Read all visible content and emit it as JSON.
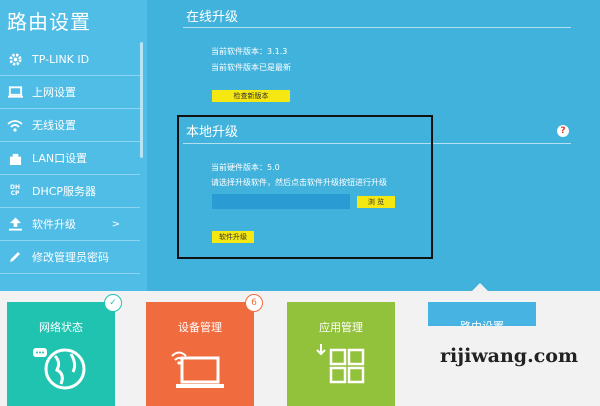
{
  "app": {
    "title": "路由设置"
  },
  "sidebar": {
    "items": [
      {
        "label": "TP-LINK ID",
        "icon": "gear-icon"
      },
      {
        "label": "上网设置",
        "icon": "laptop-icon"
      },
      {
        "label": "无线设置",
        "icon": "wifi-icon"
      },
      {
        "label": "LAN口设置",
        "icon": "lan-port-icon"
      },
      {
        "label": "DHCP服务器",
        "icon": "dhcp-icon"
      },
      {
        "label": "软件升级",
        "icon": "upload-icon",
        "chevron": ">"
      },
      {
        "label": "修改管理员密码",
        "icon": "pencil-icon"
      }
    ]
  },
  "online_upgrade": {
    "title": "在线升级",
    "current_version": "当前软件版本：3.1.3",
    "status": "当前软件版本已是最新",
    "check_button": "检查新版本"
  },
  "local_upgrade": {
    "title": "本地升级",
    "help": "?",
    "hardware_version": "当前硬件版本：5.0",
    "instruction": "请选择升级软件，然后点击软件升级按钮进行升级",
    "file_value": "",
    "browse_button": "浏 览",
    "upgrade_button": "软件升级"
  },
  "tiles": [
    {
      "label": "网络状态",
      "color": "#1fc3b0",
      "badge": "✓"
    },
    {
      "label": "设备管理",
      "color": "#f06b3e",
      "badge": "6"
    },
    {
      "label": "应用管理",
      "color": "#92c13b"
    },
    {
      "label": "路由设置",
      "color": "#46b3e2"
    }
  ],
  "watermark": "rijiwang.com"
}
